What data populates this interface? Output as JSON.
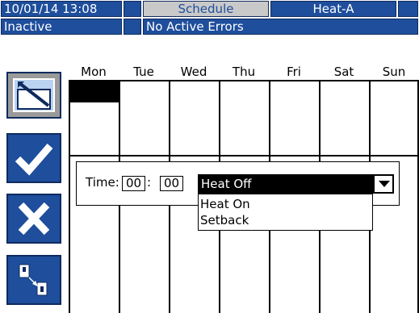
{
  "header": {
    "datetime": "10/01/14 13:08",
    "screen_tab": "Schedule",
    "zone_tab": "Heat-A",
    "status": "Inactive",
    "errors": "No Active Errors"
  },
  "schedule": {
    "days": [
      "Mon",
      "Tue",
      "Wed",
      "Thu",
      "Fri",
      "Sat",
      "Sun"
    ]
  },
  "sidebar": {
    "edit_icon": "edit-icon",
    "accept_icon": "check-icon",
    "cancel_icon": "x-icon",
    "switch_icon": "screen-switch-icon"
  },
  "dialog": {
    "time_label": "Time:",
    "hours": "00",
    "separator": ":",
    "minutes": "00",
    "dropdown_selected": "Heat Off",
    "options": [
      "Heat On",
      "Setback"
    ]
  },
  "colors": {
    "accent_blue": "#1e4e9c",
    "border_dark": "#0f2b5e",
    "tab_gray": "#c9c9c9",
    "selection_black": "#000000"
  }
}
